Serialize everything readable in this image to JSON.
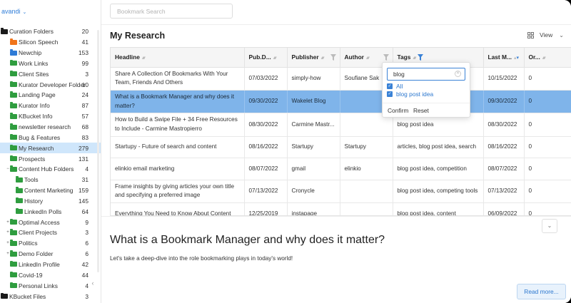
{
  "user": {
    "name": "avandi"
  },
  "sidebar": {
    "folders": [
      {
        "name": "Curation Folders",
        "count": "20",
        "color": "#1a1a1a",
        "indent": 0,
        "expand": "-"
      },
      {
        "name": "Silicon Speech",
        "count": "41",
        "color": "#f0741a",
        "indent": 1,
        "expand": ""
      },
      {
        "name": "Newchip",
        "count": "153",
        "color": "#2e7bd6",
        "indent": 1,
        "expand": ""
      },
      {
        "name": "Work Links",
        "count": "99",
        "color": "#2f9d3f",
        "indent": 1,
        "expand": ""
      },
      {
        "name": "Client Sites",
        "count": "3",
        "color": "#2f9d3f",
        "indent": 1,
        "expand": ""
      },
      {
        "name": "Kurator Developer Folder",
        "count": "10",
        "color": "#2f9d3f",
        "indent": 1,
        "expand": ""
      },
      {
        "name": "Landing Page",
        "count": "24",
        "color": "#2f9d3f",
        "indent": 1,
        "expand": ""
      },
      {
        "name": "Kurator Info",
        "count": "87",
        "color": "#2f9d3f",
        "indent": 1,
        "expand": ""
      },
      {
        "name": "KBucket Info",
        "count": "57",
        "color": "#2f9d3f",
        "indent": 1,
        "expand": ""
      },
      {
        "name": "newsletter research",
        "count": "68",
        "color": "#2f9d3f",
        "indent": 1,
        "expand": ""
      },
      {
        "name": "Bug & Features",
        "count": "83",
        "color": "#2f9d3f",
        "indent": 1,
        "expand": ""
      },
      {
        "name": "My Research",
        "count": "279",
        "color": "#2f9d3f",
        "indent": 1,
        "expand": "",
        "active": true
      },
      {
        "name": "Prospects",
        "count": "131",
        "color": "#2f9d3f",
        "indent": 1,
        "expand": ""
      },
      {
        "name": "Content Hub Folders",
        "count": "4",
        "color": "#2f9d3f",
        "indent": 1,
        "expand": "-"
      },
      {
        "name": "Tools",
        "count": "31",
        "color": "#2f9d3f",
        "indent": 2,
        "expand": ""
      },
      {
        "name": "Content Marketing",
        "count": "159",
        "color": "#2f9d3f",
        "indent": 2,
        "expand": ""
      },
      {
        "name": "History",
        "count": "145",
        "color": "#2f9d3f",
        "indent": 2,
        "expand": ""
      },
      {
        "name": "LinkedIn Polls",
        "count": "64",
        "color": "#2f9d3f",
        "indent": 2,
        "expand": ""
      },
      {
        "name": "Optimal Access",
        "count": "9",
        "color": "#2f9d3f",
        "indent": 1,
        "expand": "+"
      },
      {
        "name": "Client Projects",
        "count": "3",
        "color": "#2f9d3f",
        "indent": 1,
        "expand": "+"
      },
      {
        "name": "Politics",
        "count": "6",
        "color": "#2f9d3f",
        "indent": 1,
        "expand": "+"
      },
      {
        "name": "Demo Folder",
        "count": "6",
        "color": "#2f9d3f",
        "indent": 1,
        "expand": "+"
      },
      {
        "name": "LinkedIn Profile",
        "count": "42",
        "color": "#2f9d3f",
        "indent": 1,
        "expand": ""
      },
      {
        "name": "Covid-19",
        "count": "44",
        "color": "#2f9d3f",
        "indent": 1,
        "expand": ""
      },
      {
        "name": "Personal Links",
        "count": "4",
        "color": "#2f9d3f",
        "indent": 1,
        "expand": ""
      },
      {
        "name": "KBucket Files",
        "count": "3",
        "color": "#1a1a1a",
        "indent": 0,
        "expand": "+"
      }
    ],
    "collapse_icon": "chevron-left-icon"
  },
  "search": {
    "placeholder": "Bookmark Search",
    "value": ""
  },
  "page_title": "My Research",
  "view": {
    "label": "View",
    "icon": "grid-icon"
  },
  "table": {
    "columns": [
      {
        "label": "Headline",
        "sort": true,
        "filter": false
      },
      {
        "label": "Pub.D...",
        "sort": true,
        "filter": false
      },
      {
        "label": "Publisher",
        "sort": true,
        "filter": true
      },
      {
        "label": "Author",
        "sort": true,
        "filter": true
      },
      {
        "label": "Tags",
        "sort": true,
        "filter": true,
        "filter_active": true
      },
      {
        "label": "Last M...",
        "sort": true,
        "filter": false,
        "sort_active": true
      },
      {
        "label": "Or...",
        "sort": true,
        "filter": false
      }
    ],
    "rows": [
      {
        "headline": "Share A Collection Of Bookmarks With Your Team, Friends And Others",
        "pub_date": "07/03/2022",
        "publisher": "simply-how",
        "author": "Soufiane Sak",
        "tags": "",
        "last_modified": "10/15/2022",
        "order": "0"
      },
      {
        "headline": "What is a Bookmark Manager and why does it matter?",
        "pub_date": "09/30/2022",
        "publisher": "Wakelet Blog",
        "author": "",
        "tags": "",
        "last_modified": "09/30/2022",
        "order": "0",
        "selected": true
      },
      {
        "headline": "How to Build a Swipe File + 34 Free Resources to Include - Carmine Mastropierro",
        "pub_date": "08/30/2022",
        "publisher": "Carmine Mastr...",
        "author": "",
        "tags": "blog post idea",
        "last_modified": "08/30/2022",
        "order": "0"
      },
      {
        "headline": "Startupy - Future of search and content",
        "pub_date": "08/16/2022",
        "publisher": "Startupy",
        "author": "Startupy",
        "tags": "articles, blog post idea, search",
        "last_modified": "08/16/2022",
        "order": "0"
      },
      {
        "headline": "elinkio email marketing",
        "pub_date": "08/07/2022",
        "publisher": "gmail",
        "author": "elinkio",
        "tags": "blog post idea, competition",
        "last_modified": "08/07/2022",
        "order": "0"
      },
      {
        "headline": "Frame insights by giving articles your own title and specifying a preferred image",
        "pub_date": "07/13/2022",
        "publisher": "Cronycle",
        "author": "",
        "tags": "blog post idea, competing tools",
        "last_modified": "07/13/2022",
        "order": "0"
      },
      {
        "headline": "Everything You Need to Know About Content",
        "pub_date": "12/25/2019",
        "publisher": "instapage",
        "author": "",
        "tags": "blog post idea, content",
        "last_modified": "06/09/2022",
        "order": "0"
      }
    ]
  },
  "tag_filter": {
    "value": "blog",
    "options": [
      {
        "label": "All",
        "checked": true
      },
      {
        "label": "blog post idea",
        "checked": true
      }
    ],
    "confirm_label": "Confirm",
    "reset_label": "Reset"
  },
  "detail": {
    "title": "What is a Bookmark Manager and why does it matter?",
    "summary": "Let's take a deep-dive into the role bookmarking plays in today's world!",
    "read_more_label": "Read more..."
  },
  "colors": {
    "accent": "#3a82d6",
    "selected_row": "#7fb4ea",
    "active_folder": "#cfe6fb"
  }
}
